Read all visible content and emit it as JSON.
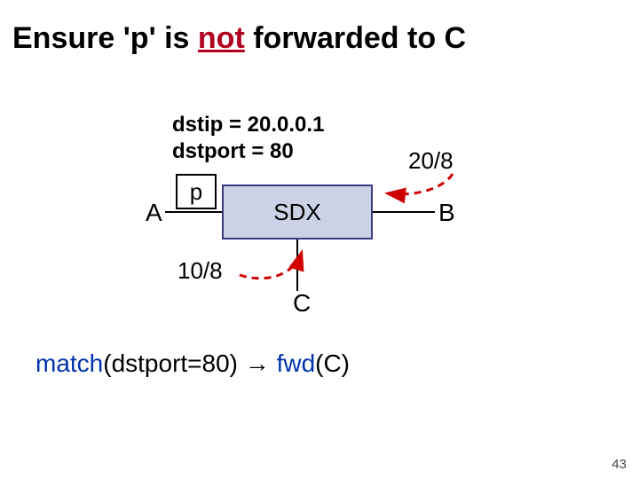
{
  "title_pre": "Ensure 'p' is ",
  "title_not": "not",
  "title_post": " forwarded to C",
  "packet": {
    "dstip_line": "dstip = 20.0.0.1",
    "dstport_line": "dstport = 80"
  },
  "prefixes": {
    "b": "20/8",
    "c": "10/8"
  },
  "nodes": {
    "a": "A",
    "b": "B",
    "c": "C",
    "sdx": "SDX",
    "packet_label": "p"
  },
  "rule": {
    "match_kw": "match",
    "match_args": "(dstport=80) ",
    "arrow": "→",
    "space": " ",
    "fwd_kw": "fwd",
    "fwd_args": "(C)"
  },
  "slide_number": "43"
}
